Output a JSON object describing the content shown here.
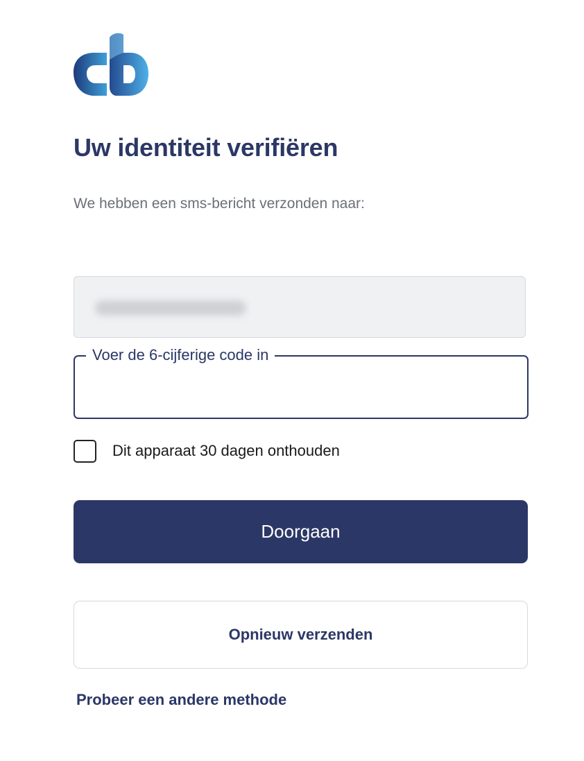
{
  "brand": {
    "logo_icon": "cb-logo-icon",
    "colors": {
      "primary": "#2b3766",
      "logo_light_blue": "#3f9fd9",
      "logo_dark_blue": "#1d3a7a"
    }
  },
  "header": {
    "title": "Uw identiteit verifiëren",
    "subtitle": "We hebben een sms-bericht verzonden naar:"
  },
  "form": {
    "phone_value_blurred": "",
    "code_label": "Voer de 6-cijferige code in",
    "code_value": "",
    "remember_label": "Dit apparaat 30 dagen onthouden",
    "remember_checked": false,
    "continue_label": "Doorgaan",
    "resend_label": "Opnieuw verzenden",
    "other_method_label": "Probeer een andere methode"
  }
}
